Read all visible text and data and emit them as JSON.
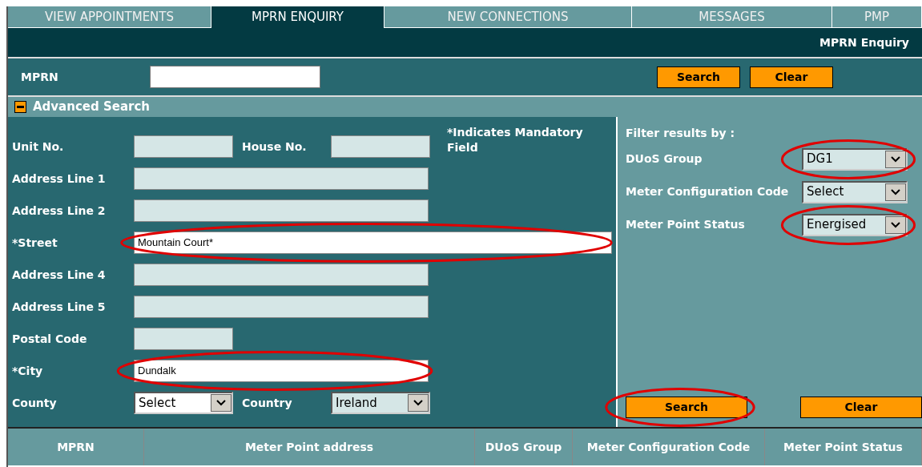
{
  "tabs": [
    {
      "label": "VIEW APPOINTMENTS",
      "selected": false
    },
    {
      "label": "MPRN ENQUIRY",
      "selected": true
    },
    {
      "label": "NEW CONNECTIONS",
      "selected": false
    },
    {
      "label": "MESSAGES",
      "selected": false
    },
    {
      "label": "PMP",
      "selected": false
    }
  ],
  "page_title": "MPRN Enquiry",
  "mprn": {
    "label": "MPRN",
    "buttons": [
      "Search",
      "Clear"
    ]
  },
  "advanced_search": {
    "title": "Advanced Search",
    "expanded": true,
    "note": "*Indicates Mandatory Field",
    "rows": [
      {
        "fields": [
          {
            "label": "Unit No.",
            "kind": "short",
            "mandatory": false,
            "highlighted": false
          },
          {
            "label": "House No.",
            "kind": "short",
            "mandatory": false,
            "highlighted": false
          }
        ]
      },
      {
        "fields": [
          {
            "label": "Address Line 1",
            "kind": "long",
            "mandatory": false,
            "highlighted": false
          }
        ]
      },
      {
        "fields": [
          {
            "label": "Address Line 2",
            "kind": "long",
            "mandatory": false,
            "highlighted": false
          }
        ]
      },
      {
        "fields": [
          {
            "label": "*Street",
            "kind": "wide",
            "mandatory": true,
            "value": "Mountain Court*",
            "highlighted": true
          }
        ]
      },
      {
        "fields": [
          {
            "label": "Address Line 4",
            "kind": "long",
            "mandatory": false,
            "highlighted": false
          }
        ]
      },
      {
        "fields": [
          {
            "label": "Address Line 5",
            "kind": "long",
            "mandatory": false,
            "highlighted": false
          }
        ]
      },
      {
        "fields": [
          {
            "label": "Postal Code",
            "kind": "short",
            "mandatory": false,
            "highlighted": false
          }
        ]
      },
      {
        "fields": [
          {
            "label": "*City",
            "kind": "long",
            "mandatory": true,
            "value": "Dundalk",
            "highlighted": true
          }
        ]
      },
      {
        "fields": [
          {
            "label": "County",
            "kind": "select",
            "disabled": false,
            "value": "Select",
            "highlighted": false
          },
          {
            "label": "Country",
            "kind": "select",
            "disabled": true,
            "value": "Ireland",
            "highlighted": false
          }
        ]
      }
    ]
  },
  "filters": {
    "title": "Filter results by :",
    "items": [
      {
        "label": "DUoS Group",
        "value": "DG1",
        "highlighted": true
      },
      {
        "label": "Meter Configuration Code",
        "value": "Select",
        "highlighted": false
      },
      {
        "label": "Meter Point Status",
        "value": "Energised",
        "highlighted": true
      }
    ],
    "buttons": [
      {
        "label": "Search",
        "highlighted": true
      },
      {
        "label": "Clear",
        "highlighted": false
      }
    ]
  },
  "results": {
    "columns": [
      "MPRN",
      "Meter Point address",
      "DUoS Group",
      "Meter Configuration Code",
      "Meter Point Status"
    ]
  }
}
